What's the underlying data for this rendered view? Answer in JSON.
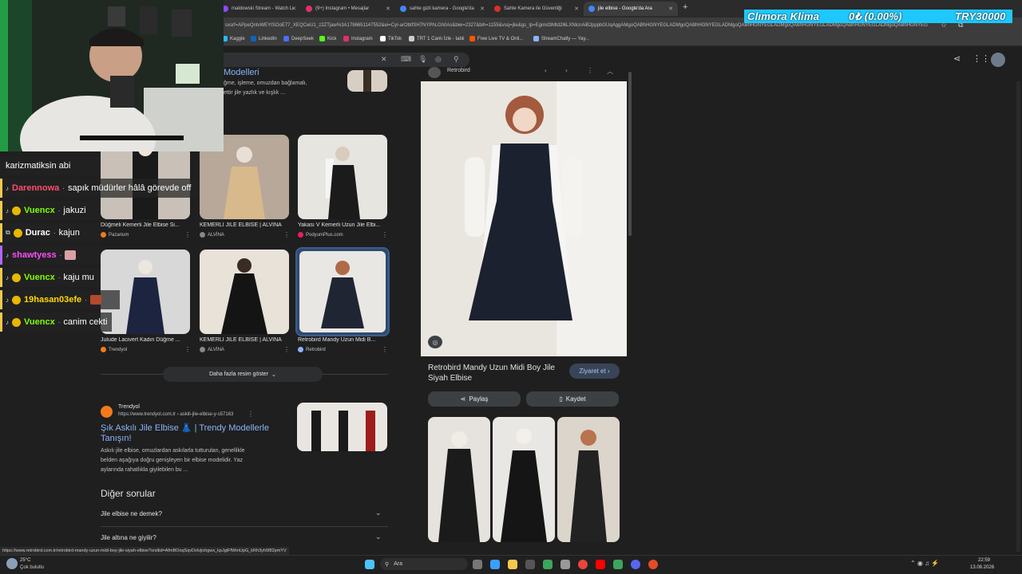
{
  "browser": {
    "tabs": [
      {
        "title": "maldowski Stream - Watch Li",
        "color": "#9146ff",
        "active": false
      },
      {
        "title": "(9+) Instagram • Mesajlar",
        "color": "#e1306c",
        "active": false
      },
      {
        "title": "sahte gizli kamera - Google'da",
        "color": "#4285f4",
        "active": false
      },
      {
        "title": "Sahte Kamera ile Güvenliği",
        "color": "#d93025",
        "active": false
      },
      {
        "title": "jile elbise - Google'da Ara",
        "color": "#4285f4",
        "active": true
      }
    ],
    "new_tab": "+",
    "url": "sxsrf=APpeQntvWEYtSOoE77_XEQCwU1_z2ZTjaw%3A1786651147552&ei=CyI-arObtfSH7NYPhLGh0As&biw=2327&bih=1155&vsq=jile&gs_lp=Egimd3Mtd2l6LXNlcnAiB2pppbGUqAggAMgoQABhHGNYEGLADMgoQABhHGNYEGLADMgoQABhHGNYEGLADMgoQABhHGNYEGLADMgoQABhHGNYEGLADMgoQABhHGNYEGLAD",
    "bookmarks": [
      {
        "label": "Kaggle",
        "color": "#20beff"
      },
      {
        "label": "LinkedIn",
        "color": "#0a66c2"
      },
      {
        "label": "DeepSeek",
        "color": "#4d6bfe"
      },
      {
        "label": "Kick",
        "color": "#53fc18"
      },
      {
        "label": "Instagram",
        "color": "#e1306c"
      },
      {
        "label": "TikTok",
        "color": "#ffffff"
      },
      {
        "label": "TRT 1 Canlı İzle - tabii",
        "color": "#cccccc"
      },
      {
        "label": "Free Live TV & Onli...",
        "color": "#ff5500"
      },
      {
        "label": "StreamChatly — Yay...",
        "color": "#8ab4f8"
      }
    ]
  },
  "overlay": {
    "name": "Clımora Klima",
    "change": "0₺ (0.00%)",
    "price": "TRY30000"
  },
  "results": {
    "top_snippet_title": "Modelleri",
    "top_snippet_text": "ğme, işleme, omuzdan bağlamalı,",
    "top_snippet_text2": "ettir jile yazlık ve kışlık ...",
    "images": [
      {
        "caption": "Düğmeli Kemerli Jile Elbise Si...",
        "source": "Pazarium",
        "color": "#f27a1a"
      },
      {
        "caption": "KEMERLİ JİLE ELBİSE | ALVİNA",
        "source": "ALVİNA",
        "color": "#888888"
      },
      {
        "caption": "Yakası V Kemerli Uzun Jile Elbi...",
        "source": "PodyumPlus.com",
        "color": "#e91e63"
      },
      {
        "caption": "Julude Lacivert Kadın Düğme ...",
        "source": "Trendyol",
        "color": "#f27a1a"
      },
      {
        "caption": "KEMERLİ JİLE ELBİSE | ALVİNA",
        "source": "ALVİNA",
        "color": "#888888"
      },
      {
        "caption": "Retrobird Mandy Uzun Midi B...",
        "source": "Retrobird",
        "color": "#8ab4f8"
      }
    ],
    "more_images": "Daha fazla resim göster",
    "trendyol": {
      "site": "Trendyol",
      "url": "https://www.trendyol.com.tr › askili-jile-elbise-y-s57163",
      "title_line1": "Şık Askılı Jile Elbise 👗 | Trendy Modellerle",
      "title_line2": "Tanışın!",
      "snippet_l1": "Askılı jile elbise, omuzlardan askılarla tutturulan, genellikle",
      "snippet_l2": "belden aşağıya doğru genişleyen bir elbise modelidir. Yaz",
      "snippet_l3": "aylarında rahatlıkla giyilebilen bu ..."
    },
    "other_questions_title": "Diğer sorular",
    "questions": [
      "Jile elbise ne demek?",
      "Jile altına ne giyilir?"
    ]
  },
  "panel": {
    "source": "Retrobird",
    "title_line1": "Retrobird Mandy Uzun Midi Boy Jile",
    "title_line2": "Siyah Elbise",
    "visit": "Ziyaret et ›",
    "share": "Paylaş",
    "save": "Kaydet"
  },
  "chat": [
    {
      "user": "",
      "msg": "karizmatiksin abi",
      "user_color": "#ffffff"
    },
    {
      "user": "Darennowa",
      "msg": "sapık müdürler hâlâ görevde off",
      "user_color": "#ff4d6d"
    },
    {
      "user": "Vuencx",
      "msg": "jakuzi",
      "user_color": "#7fff00"
    },
    {
      "user": "Durac",
      "msg": "kajun",
      "user_color": "#ffffff"
    },
    {
      "user": "shawtyess",
      "msg": "",
      "user_color": "#ff4dff"
    },
    {
      "user": "Vuencx",
      "msg": "kaju mu",
      "user_color": "#7fff00"
    },
    {
      "user": "19hasan03efe",
      "msg": "",
      "user_color": "#ffd700"
    },
    {
      "user": "Vuencx",
      "msg": "canim cekti",
      "user_color": "#7fff00"
    }
  ],
  "status_url": "https://www.retrobird.com.tr/retrobird-mandy-uzun-midi-boy-jile-siyah-elbise?srsltid=AfmBOoqSqvDxtvjichgwx_kpJgtFfWmUpG_kRh3yh5f82pmYV",
  "taskbar": {
    "weather_temp": "25°C",
    "weather_desc": "Çok bulutlu",
    "search": "Ara",
    "time": "22:59",
    "date": "13.08.2026"
  }
}
